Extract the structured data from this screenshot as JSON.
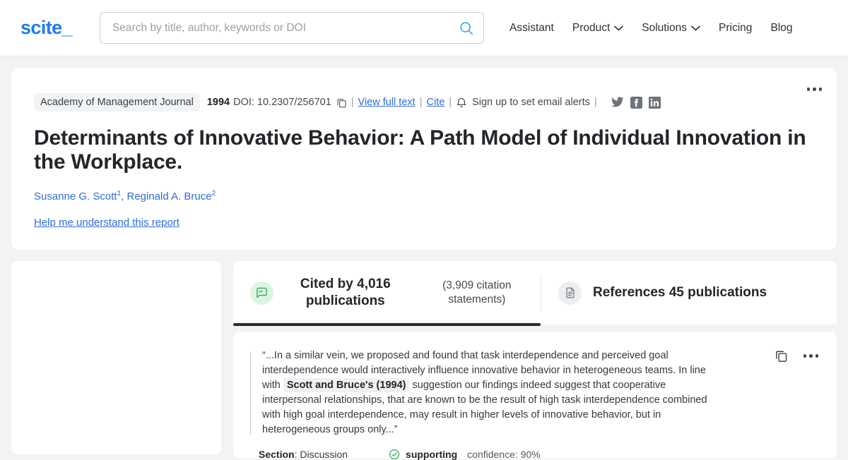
{
  "header": {
    "logo": "scite_",
    "search": {
      "placeholder": "Search by title, author, keywords or DOI",
      "value": "",
      "icon": "search-icon"
    },
    "nav": [
      {
        "label": "Assistant",
        "caret": false
      },
      {
        "label": "Product",
        "caret": true
      },
      {
        "label": "Solutions",
        "caret": true
      },
      {
        "label": "Pricing",
        "caret": false
      },
      {
        "label": "Blog",
        "caret": false
      }
    ]
  },
  "paper": {
    "journal": "Academy of Management Journal",
    "year": "1994",
    "doi": "DOI: 10.2307/256701",
    "copy_icon": "copy-icon",
    "sep": "|",
    "view_full_text": "View full text",
    "cite": "Cite",
    "bell_icon": "bell-icon",
    "email_alerts": "Sign up to set email alerts",
    "social": [
      {
        "name": "twitter-icon"
      },
      {
        "name": "facebook-icon"
      },
      {
        "name": "linkedin-icon"
      }
    ],
    "title": "Determinants of Innovative Behavior: A Path Model of Individual Innovation in the Workplace.",
    "authors": [
      {
        "name": "Susanne G. Scott",
        "sup": "1",
        "trail": ","
      },
      {
        "name": "Reginald A. Bruce",
        "sup": "2",
        "trail": ""
      }
    ],
    "help_link": "Help me understand this report",
    "more_menu": "more-options"
  },
  "tabs": [
    {
      "id": "cited-by",
      "icon": "quote-bubble-icon",
      "title": "Cited by 4,016 publications",
      "subtitle": "(3,909 citation statements)",
      "active": true
    },
    {
      "id": "references",
      "icon": "document-icon",
      "title": "References 45 publications",
      "active": false
    }
  ],
  "citation": {
    "text_before": "“...In a similar vein, we proposed and found that task interdependence and perceived goal interdependence would interactively influence innovative behavior in heterogeneous teams. In line with",
    "highlight": "Scott and Bruce's (1994)",
    "text_after": "suggestion our findings indeed suggest that cooperative interpersonal relationships, that are known to be the result of high task interdependence combined with high goal interdependence, may result in higher levels of innovative behavior, but in heterogeneous groups only...”",
    "copy_icon": "copy-icon",
    "more_menu": "more-options",
    "section_label": "Section",
    "section_value": ": Discussion",
    "check_icon": "check-circle-icon",
    "classification": "supporting",
    "confidence": "confidence: 90%"
  },
  "colors": {
    "brand": "#1f7bf5",
    "link": "#2d6cdf",
    "supporting_green": "#3aa75a",
    "active_tab_underline": "#272c33",
    "page_bg": "#f2f3f4"
  }
}
